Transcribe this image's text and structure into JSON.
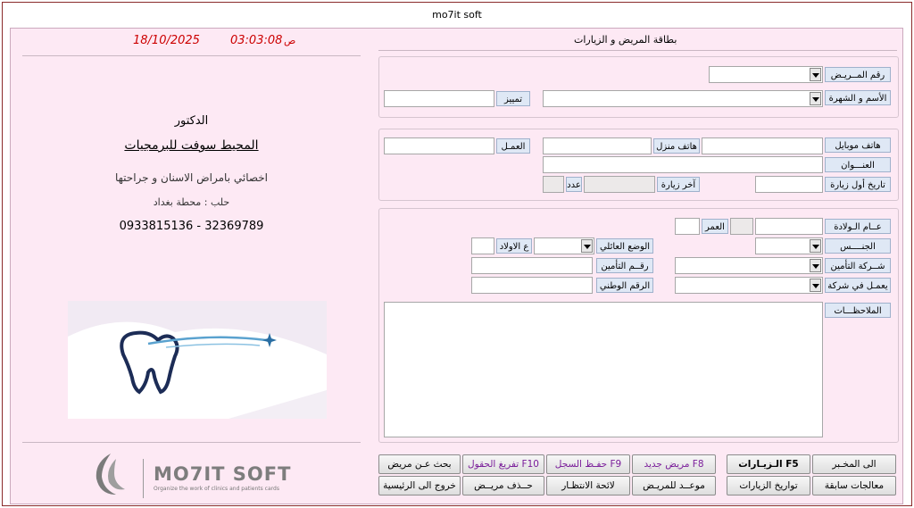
{
  "window": {
    "title": "mo7it soft"
  },
  "header": {
    "section_title": "بطاقة المريض و الزيارات",
    "date": "18/10/2025",
    "time": "03:03:08",
    "ampm": "ص"
  },
  "doctor": {
    "title": "الدكتور",
    "name": "المحيط سوفت للبرمجيات",
    "specialty": "اخصائي بامراض الاسنان و جراحتها",
    "address": "حلب : محطة بغداد",
    "phones": "0933815136 - 32369789"
  },
  "brand": {
    "name": "MO7IT SOFT",
    "tagline": "Organize the work of clinics and patients cards"
  },
  "fields": {
    "patient_number": "رقم المــريـض",
    "name_nickname": "الأسم و الشهرة",
    "distinguish": "تمييز",
    "mobile": "هاتف موبايل",
    "home_phone": "هاتف منزل",
    "work": "العمـل",
    "address": "العنـــوان",
    "first_visit": "تاريخ أول زيارة",
    "last_visit": "آخر زيارة",
    "count": "عدد",
    "birth_year": "عــام الـولادة",
    "age": "العمر",
    "gender": "الجنــــس",
    "marital": "الوضع العائلي",
    "children": "ع الاولاد",
    "insurance_company": "شــركة التأمين",
    "insurance_number": "رقــم التأمين",
    "works_at_company": "يعمـل في شركة",
    "national_id": "الرقم الوطني",
    "notes": "الملاحظـــات"
  },
  "buttons": {
    "to_lab": "الى المخـبر",
    "visits": "الـزيـارات   F5",
    "new_patient": "مريض جديد  F8",
    "save_record": "حفـظ السجل  F9",
    "clear_fields": "تفريغ الحقول F10",
    "search_patient": "بحث عـن مريض",
    "prev_treatments": "معالجات سابقة",
    "visit_dates": "تواريخ الزيارات",
    "appointment": "موعــد للمريـض",
    "waiting_list": "لائحة الانتظـار",
    "delete_patient": "حــذف مريــض",
    "exit_home": "خروج الى الرئيسية"
  }
}
